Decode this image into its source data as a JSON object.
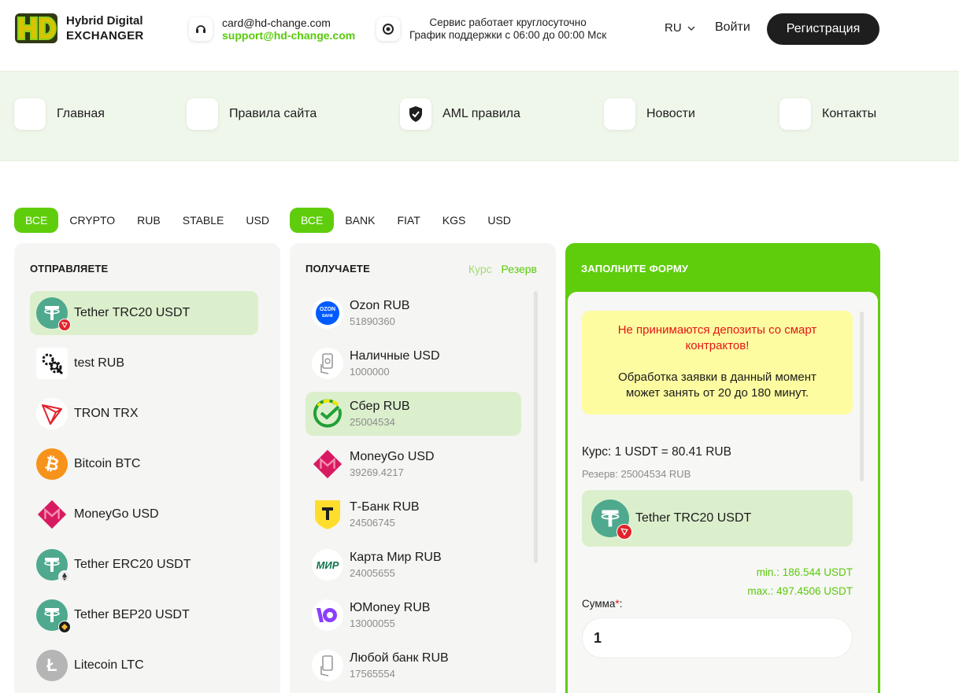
{
  "header": {
    "logo_line1": "Hybrid Digital",
    "logo_line2": "EXCHANGER",
    "email_main": "card@hd-change.com",
    "email_support": "support@hd-change.com",
    "service_line1": "Сервис работает круглосуточно",
    "service_line2": "График поддержки с 06:00 до 00:00 Мск",
    "lang": "RU",
    "login": "Войти",
    "register": "Регистрация"
  },
  "nav": {
    "items": [
      {
        "label": "Главная"
      },
      {
        "label": "Правила сайта"
      },
      {
        "label": "AML правила"
      },
      {
        "label": "Новости"
      },
      {
        "label": "Контакты"
      }
    ]
  },
  "send_filters": [
    "ВСЕ",
    "CRYPTO",
    "RUB",
    "STABLE",
    "USD"
  ],
  "receive_filters": [
    "ВСЕ",
    "BANK",
    "FIAT",
    "KGS",
    "USD"
  ],
  "send_panel": {
    "title": "ОТПРАВЛЯЕТЕ",
    "items": [
      {
        "name": "Tether TRC20 USDT",
        "icon": "tether-trc20-icon"
      },
      {
        "name": "test RUB",
        "icon": "gears-icon"
      },
      {
        "name": "TRON TRX",
        "icon": "tron-icon"
      },
      {
        "name": "Bitcoin BTC",
        "icon": "bitcoin-icon"
      },
      {
        "name": "MoneyGo USD",
        "icon": "moneygo-icon"
      },
      {
        "name": "Tether ERC20 USDT",
        "icon": "tether-erc20-icon"
      },
      {
        "name": "Tether BEP20 USDT",
        "icon": "tether-bep20-icon"
      },
      {
        "name": "Litecoin LTC",
        "icon": "litecoin-icon"
      }
    ]
  },
  "receive_panel": {
    "title": "ПОЛУЧАЕТЕ",
    "rate_label": "Курс",
    "reserve_label": "Резерв",
    "items": [
      {
        "name": "Ozon RUB",
        "reserve": "51890360",
        "icon": "ozon-bank-icon"
      },
      {
        "name": "Наличные USD",
        "reserve": "1000000",
        "icon": "cash-icon"
      },
      {
        "name": "Сбер RUB",
        "reserve": "25004534",
        "icon": "sber-icon"
      },
      {
        "name": "MoneyGo USD",
        "reserve": "39269.4217",
        "icon": "moneygo-icon"
      },
      {
        "name": "Т-Банк RUB",
        "reserve": "24506745",
        "icon": "tbank-icon"
      },
      {
        "name": "Карта Мир RUB",
        "reserve": "24005655",
        "icon": "mir-icon"
      },
      {
        "name": "ЮMoney RUB",
        "reserve": "13000055",
        "icon": "yoomoney-icon"
      },
      {
        "name": "Любой банк RUB",
        "reserve": "17565554",
        "icon": "any-bank-icon"
      }
    ]
  },
  "form": {
    "title": "ЗАПОЛНИТЕ ФОРМУ",
    "warning_red": "Не принимаются депозиты со смарт контрактов!",
    "warning_text": "Обработка заявки в данный момент может занять от 20 до 180 минут.",
    "rate_label": "Курс:",
    "rate_value": "1 USDT = 80.41 RUB",
    "reserve_label": "Резерв:",
    "reserve_value": "25004534 RUB",
    "selected_currency": "Tether TRC20 USDT",
    "min": "min.: 186.544 USDT",
    "max": "max.: 497.4506 USDT",
    "sum_label": "Сумма",
    "sum_required": "*",
    "sum_suffix": ":",
    "sum_value": "1"
  },
  "colors": {
    "accent": "#5fcd0c",
    "active_row": "#dcefcd",
    "warning_bg": "#fefca0",
    "warning_red": "#e41515"
  }
}
